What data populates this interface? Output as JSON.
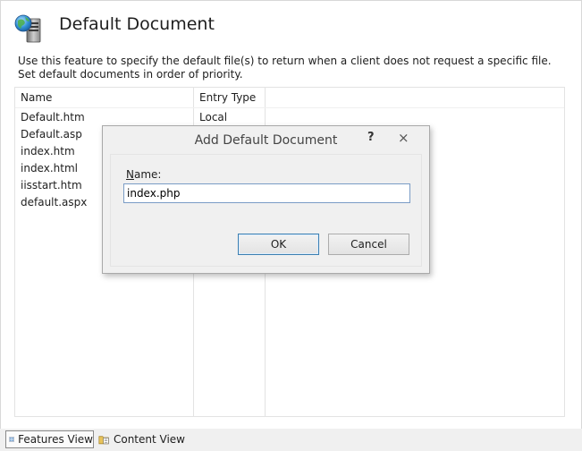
{
  "page": {
    "title": "Default Document",
    "description": "Use this feature to specify the default file(s) to return when a client does not request a specific file. Set default documents in order of priority.",
    "icon": "globe-server-icon"
  },
  "list": {
    "columns": [
      "Name",
      "Entry Type"
    ],
    "rows": [
      {
        "name": "Default.htm",
        "type": "Local"
      },
      {
        "name": "Default.asp",
        "type": ""
      },
      {
        "name": "index.htm",
        "type": ""
      },
      {
        "name": "index.html",
        "type": ""
      },
      {
        "name": "iisstart.htm",
        "type": ""
      },
      {
        "name": "default.aspx",
        "type": ""
      }
    ]
  },
  "bottom_tabs": [
    {
      "label": "Features View",
      "active": true,
      "icon": "features-view-icon"
    },
    {
      "label": "Content View",
      "active": false,
      "icon": "content-view-icon"
    }
  ],
  "dialog": {
    "title": "Add Default Document",
    "help": "?",
    "close": "×",
    "name_label_accel": "N",
    "name_label_rest": "ame:",
    "name_value": "index.php",
    "ok_label": "OK",
    "cancel_label": "Cancel"
  },
  "colors": {
    "window_bg": "#ffffff",
    "dialog_bg": "#f0f0f0",
    "input_border": "#7a9cc6",
    "default_button_border": "#3c7fb1"
  }
}
